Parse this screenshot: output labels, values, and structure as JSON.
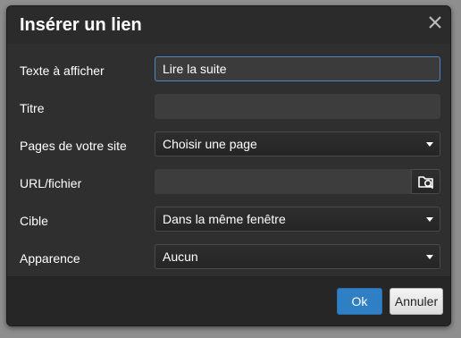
{
  "dialog": {
    "title": "Insérer un lien",
    "close_icon": "close-icon"
  },
  "form": {
    "display_text": {
      "label": "Texte à afficher",
      "value": "Lire la suite"
    },
    "title": {
      "label": "Titre",
      "value": ""
    },
    "site_pages": {
      "label": "Pages de votre site",
      "selected": "Choisir une page"
    },
    "url": {
      "label": "URL/fichier",
      "value": "",
      "browse_icon": "folder-search-icon"
    },
    "target": {
      "label": "Cible",
      "selected": "Dans la même fenêtre"
    },
    "appearance": {
      "label": "Apparence",
      "selected": "Aucun"
    }
  },
  "footer": {
    "ok_label": "Ok",
    "cancel_label": "Annuler"
  },
  "colors": {
    "accent": "#2f7fc5",
    "focus_border": "#4a86c6",
    "dialog_bg": "#2f2f2f",
    "backdrop": "#8e8e8e"
  }
}
